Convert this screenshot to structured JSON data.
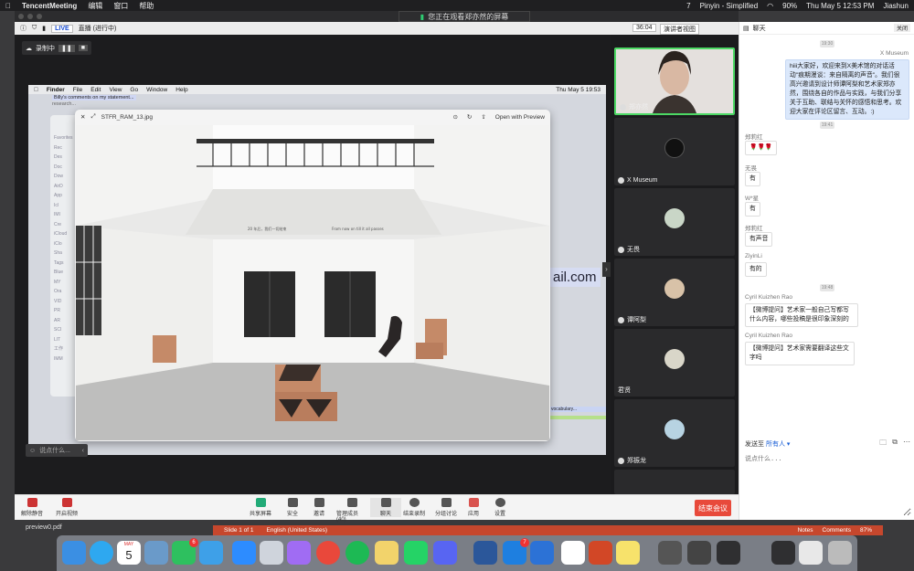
{
  "menubar": {
    "app": "TencentMeeting",
    "items": [
      "编辑",
      "窗口",
      "帮助"
    ],
    "battery": "90%",
    "date": "Thu May 5  12:53 PM",
    "user": "Jiashun",
    "input": "Pinyin - Simplified",
    "count": "7"
  },
  "share_banner": {
    "text": "您正在观看郑亦然的屏幕"
  },
  "meeting_header": {
    "live": "LIVE",
    "status": "直播 (进行中)",
    "timer": "36:04",
    "view": "演讲者视图"
  },
  "recording": {
    "label": "录制中"
  },
  "shared_screen": {
    "menu": [
      "Finder",
      "File",
      "Edit",
      "View",
      "Go",
      "Window",
      "Help"
    ],
    "menu_right": "Thu May 5  19:53",
    "note": "Billy's comments on my statement...",
    "note2": "research...",
    "finder_items": [
      "Favorites",
      "Rec",
      "Des",
      "Doc",
      "Dow",
      "AirD",
      "App",
      "Icl",
      "IMI",
      "Cre",
      "iCloud",
      "iClo",
      "Sha",
      "Tags",
      "Blue",
      "MY",
      "Ora",
      "VID",
      "PR",
      "AR",
      "SCI",
      "LIT",
      "工作",
      "IMM"
    ],
    "mail_fragment": "ail.com",
    "vocab": "vocabulary...",
    "preview": {
      "filename": "STFR_RAM_13.jpg",
      "open_with": "Open with Preview"
    },
    "wall_text_left": "20 年后，我们一切结束",
    "wall_text_right": "From now on till it all passes"
  },
  "say_something": "说点什么...",
  "toolbar": {
    "mute": "解除静音",
    "video": "开启视频",
    "share": "共享屏幕",
    "security": "安全",
    "invite": "邀请",
    "members": "管理成员(40)",
    "chat": "聊天",
    "record": "结束录制",
    "breakout": "分组讨论",
    "apps": "应用",
    "settings": "设置",
    "end": "结束会议"
  },
  "participants": [
    {
      "name": "郑亦然"
    },
    {
      "name": "X Museum"
    },
    {
      "name": "无畏"
    },
    {
      "name": "谭阿梨"
    },
    {
      "name": "君贤"
    },
    {
      "name": "郑振龙"
    }
  ],
  "chat": {
    "title": "聊天",
    "close": "关闭",
    "messages": [
      {
        "time": "19:30",
        "sender": "X Museum",
        "text": "hiii大家好，欢迎来到X美术馆的对话活动\"痕期漫谈：来自隔离的声音\"。我们很高兴邀请到设计师谭阿梨和艺术家郑亦然，围绕各自的作品与实践，与我们分享关于互助、联结与关怀的感悟和思考。欢迎大家在评论区留言、互动。:)"
      },
      {
        "time": "19:41",
        "sender": "郑莉红",
        "text": "🌹🌹🌹"
      },
      {
        "sender": "无畏",
        "text": "有"
      },
      {
        "sender": "W*星",
        "text": "有"
      },
      {
        "sender": "郑莉红",
        "text": "有声音"
      },
      {
        "sender": "ZiyinLi",
        "text": "有的"
      },
      {
        "time": "19:48",
        "sender": "Cyril Kuizhen Rao",
        "text": "【微博提问】艺术家一般自己写都写什么内容，哪些投稿是很印象深刻的"
      },
      {
        "sender": "Cyril Kuizhen Rao",
        "text": "【微博提问】艺术家需要翻译这些文字吗"
      }
    ],
    "send_to_label": "发送至",
    "send_to_value": "所有人",
    "input_placeholder": "说点什么..."
  },
  "ppt": {
    "slide": "Slide 1 of 1",
    "lang": "English (United States)",
    "notes": "Notes",
    "comments": "Comments",
    "zoom": "87%"
  },
  "desktop_file": "preview0.pdf",
  "dock": {
    "calendar_month": "MAY",
    "calendar_day": "5",
    "badges": {
      "wechat": "6",
      "mail": "7"
    }
  },
  "colors": {
    "end_red": "#e84a3b",
    "active_speaker": "#4cd964",
    "chat_me": "#dbe8fb",
    "ppt": "#c6472d"
  }
}
